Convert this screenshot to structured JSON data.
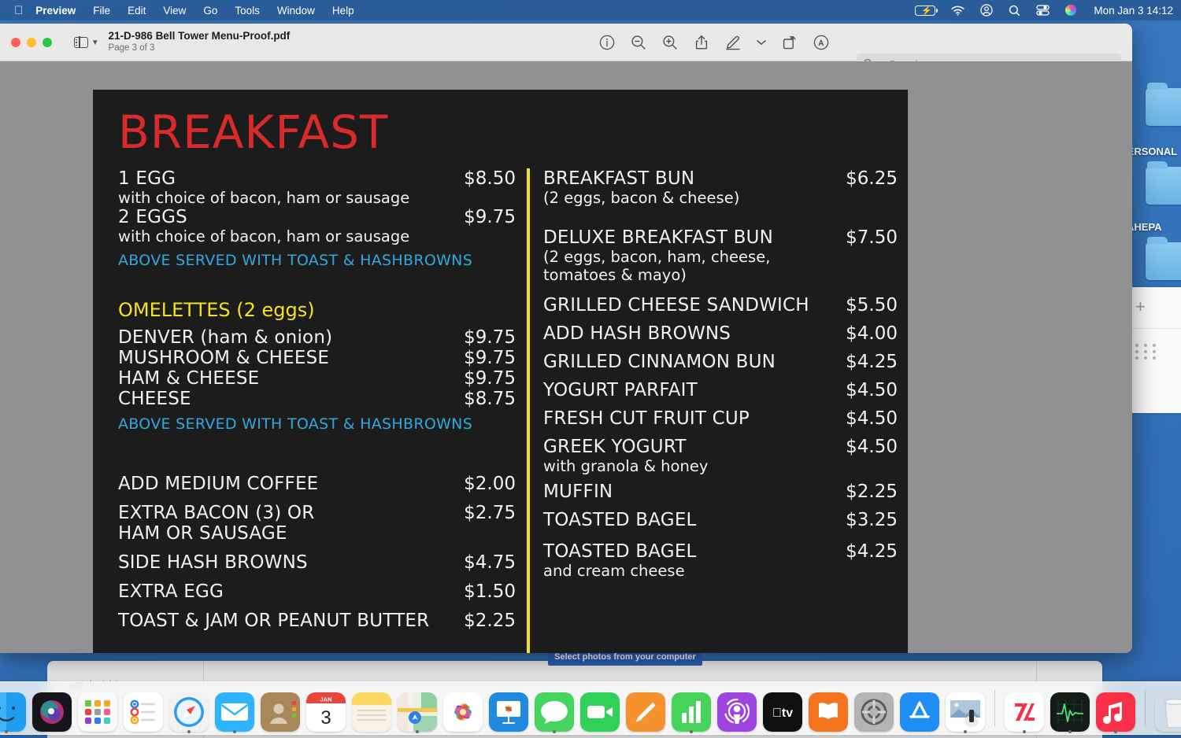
{
  "menubar": {
    "apple_icon": "apple-logo",
    "items": [
      {
        "label": "Preview",
        "active": true
      },
      {
        "label": "File",
        "active": false
      },
      {
        "label": "Edit",
        "active": false
      },
      {
        "label": "View",
        "active": false
      },
      {
        "label": "Go",
        "active": false
      },
      {
        "label": "Tools",
        "active": false
      },
      {
        "label": "Window",
        "active": false
      },
      {
        "label": "Help",
        "active": false
      }
    ],
    "status_icons": [
      "battery-charging-icon",
      "wifi-icon",
      "user-account-icon",
      "spotlight-search-icon",
      "control-center-icon",
      "siri-icon"
    ],
    "clock": "Mon Jan 3  14:12"
  },
  "window": {
    "traffic_lights": [
      "close-button",
      "minimize-button",
      "zoom-button"
    ],
    "sidebar_toggle": "sidebar-toggle-icon",
    "doc_title": "21-D-986 Bell Tower Menu-Proof.pdf",
    "doc_page": "Page 3 of 3",
    "toolbar_icons": [
      {
        "name": "info-icon"
      },
      {
        "name": "zoom-out-icon"
      },
      {
        "name": "zoom-in-icon"
      },
      {
        "name": "share-icon"
      },
      {
        "name": "markup-pen-icon"
      },
      {
        "name": "chevron-down-icon"
      },
      {
        "name": "rotate-icon"
      },
      {
        "name": "annotate-icon"
      }
    ],
    "search": {
      "placeholder": "Search",
      "value": "",
      "icon": "search-icon"
    }
  },
  "menu": {
    "title": "BREAKFAST",
    "colors": {
      "background": "#1c1c1c",
      "title_red": "#d92b2b",
      "accent_yellow": "#f5e11f",
      "note_blue": "#2ea9de",
      "text_white": "#f2f2f2"
    },
    "left": {
      "eggs": [
        {
          "name": "1 EGG",
          "price": "$8.50",
          "desc": "with choice of bacon, ham or sausage"
        },
        {
          "name": "2 EGGS",
          "price": "$9.75",
          "desc": "with choice of bacon, ham or sausage"
        }
      ],
      "eggs_note": "ABOVE SERVED WITH TOAST & HASHBROWNS",
      "omelettes_heading": "OMELETTES (2 eggs)",
      "omelettes": [
        {
          "name": "DENVER (ham & onion)",
          "price": "$9.75"
        },
        {
          "name": "MUSHROOM & CHEESE",
          "price": "$9.75"
        },
        {
          "name": "HAM & CHEESE",
          "price": "$9.75"
        },
        {
          "name": "CHEESE",
          "price": "$8.75"
        }
      ],
      "omelettes_note": "ABOVE SERVED WITH TOAST & HASHBROWNS",
      "extras": [
        {
          "name": "ADD MEDIUM COFFEE",
          "price": "$2.00",
          "desc": ""
        },
        {
          "name": "EXTRA BACON (3) OR",
          "price": "$2.75",
          "desc": "HAM OR SAUSAGE"
        },
        {
          "name": "SIDE HASH BROWNS",
          "price": "$4.75",
          "desc": ""
        },
        {
          "name": "EXTRA EGG",
          "price": "$1.50",
          "desc": ""
        },
        {
          "name": "TOAST & JAM OR PEANUT BUTTER",
          "price": "$2.25",
          "desc": ""
        }
      ]
    },
    "right": {
      "buns": [
        {
          "name": "BREAKFAST BUN",
          "price": "$6.25",
          "desc": "(2 eggs, bacon & cheese)"
        },
        {
          "name": "DELUXE BREAKFAST BUN",
          "price": "$7.50",
          "desc": "(2 eggs, bacon, ham, cheese,\ntomatoes & mayo)"
        }
      ],
      "items": [
        {
          "name": "GRILLED CHEESE SANDWICH",
          "price": "$5.50",
          "desc": ""
        },
        {
          "name": "ADD HASH BROWNS",
          "price": "$4.00",
          "desc": ""
        },
        {
          "name": "GRILLED CINNAMON BUN",
          "price": "$4.25",
          "desc": ""
        },
        {
          "name": "YOGURT PARFAIT",
          "price": "$4.50",
          "desc": ""
        },
        {
          "name": "FRESH CUT FRUIT CUP",
          "price": "$4.50",
          "desc": ""
        },
        {
          "name": "GREEK YOGURT",
          "price": "$4.50",
          "desc": "with granola & honey"
        },
        {
          "name": "MUFFIN",
          "price": "$2.25",
          "desc": ""
        },
        {
          "name": "TOASTED BAGEL",
          "price": "$3.25",
          "desc": ""
        }
      ],
      "last": {
        "name": "TOASTED BAGEL",
        "price": "$4.25",
        "desc": "and cream cheese"
      }
    }
  },
  "desktop": {
    "folders": [
      {
        "label": "PERSONAL"
      },
      {
        "label": "AHEPA"
      },
      {
        "label": ""
      }
    ],
    "bg_button": "Select photos from your computer",
    "bg_insights": "Insights"
  },
  "dock": {
    "items": [
      {
        "name": "finder",
        "glyph": "",
        "bg": "#36a9f4",
        "running": true
      },
      {
        "name": "siri",
        "glyph": "",
        "bg": "#20203a",
        "running": false
      },
      {
        "name": "launchpad",
        "glyph": "",
        "bg": "#f7f7f7",
        "running": false
      },
      {
        "name": "reminders",
        "glyph": "",
        "bg": "#ffffff",
        "running": false
      },
      {
        "name": "safari",
        "glyph": "",
        "bg": "#2e9bef",
        "running": true
      },
      {
        "name": "mail",
        "glyph": "✉",
        "bg": "#2eb4ff",
        "running": true
      },
      {
        "name": "contacts",
        "glyph": "",
        "bg": "#a98758",
        "running": false
      },
      {
        "name": "calendar",
        "glyph": "3",
        "bg": "#ffffff",
        "running": false
      },
      {
        "name": "notes",
        "glyph": "",
        "bg": "#fbe46a",
        "running": false
      },
      {
        "name": "maps",
        "glyph": "",
        "bg": "#c8e8a8",
        "running": true
      },
      {
        "name": "photos",
        "glyph": "",
        "bg": "#ffffff",
        "running": false
      },
      {
        "name": "keynote",
        "glyph": "",
        "bg": "#1f8ae0",
        "running": false
      },
      {
        "name": "messages",
        "glyph": "",
        "bg": "#45d45c",
        "running": true
      },
      {
        "name": "facetime",
        "glyph": "",
        "bg": "#2fd158",
        "running": false
      },
      {
        "name": "pages",
        "glyph": "",
        "bg": "#f5922d",
        "running": false
      },
      {
        "name": "numbers",
        "glyph": "",
        "bg": "#46d35a",
        "running": true
      },
      {
        "name": "podcasts",
        "glyph": "",
        "bg": "#9d45e0",
        "running": false
      },
      {
        "name": "apple-tv",
        "glyph": "",
        "bg": "#101010",
        "running": false
      },
      {
        "name": "books",
        "glyph": "",
        "bg": "#f5751f",
        "running": false
      },
      {
        "name": "system-preferences",
        "glyph": "",
        "bg": "#b0b0b0",
        "running": false
      },
      {
        "name": "app-store",
        "glyph": "",
        "bg": "#1e8ef5",
        "running": false
      },
      {
        "name": "preview",
        "glyph": "",
        "bg": "#dde6f0",
        "running": true
      },
      {
        "name": "news",
        "glyph": "",
        "bg": "#ffffff",
        "running": true
      },
      {
        "name": "activity-monitor",
        "glyph": "",
        "bg": "#1b2020",
        "running": true
      },
      {
        "name": "music",
        "glyph": "♪",
        "bg": "#fa2f48",
        "running": true
      },
      {
        "name": "trash",
        "glyph": "",
        "bg": "#e7e7e7",
        "running": false
      }
    ]
  }
}
